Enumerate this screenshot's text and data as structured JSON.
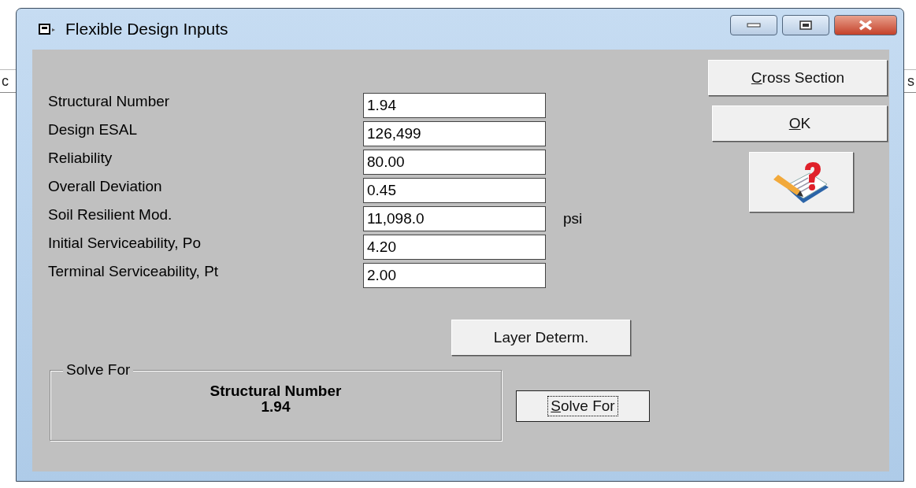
{
  "background": {
    "left_fragment": "c",
    "right_fragment": "s"
  },
  "window": {
    "title": "Flexible Design Inputs"
  },
  "inputs": [
    {
      "label": "Structural Number",
      "value": "1.94"
    },
    {
      "label": "Design ESAL",
      "value": "126,499"
    },
    {
      "label": "Reliability",
      "value": "80.00"
    },
    {
      "label": "Overall Deviation",
      "value": "0.45"
    },
    {
      "label": "Soil Resilient Mod.",
      "value": "11,098.0",
      "unit": "psi"
    },
    {
      "label": "Initial Serviceability, Po",
      "value": "4.20"
    },
    {
      "label": "Terminal Serviceability, Pt",
      "value": "2.00"
    }
  ],
  "buttons": {
    "cross_section": {
      "label": "Cross Section"
    },
    "ok": {
      "label": "OK"
    },
    "layer": {
      "label": "Layer Determ."
    },
    "solve_for": {
      "label": "Solve For",
      "focused": true
    }
  },
  "solve_group": {
    "legend": "Solve For",
    "target": "Structural Number",
    "result": "1.94"
  }
}
